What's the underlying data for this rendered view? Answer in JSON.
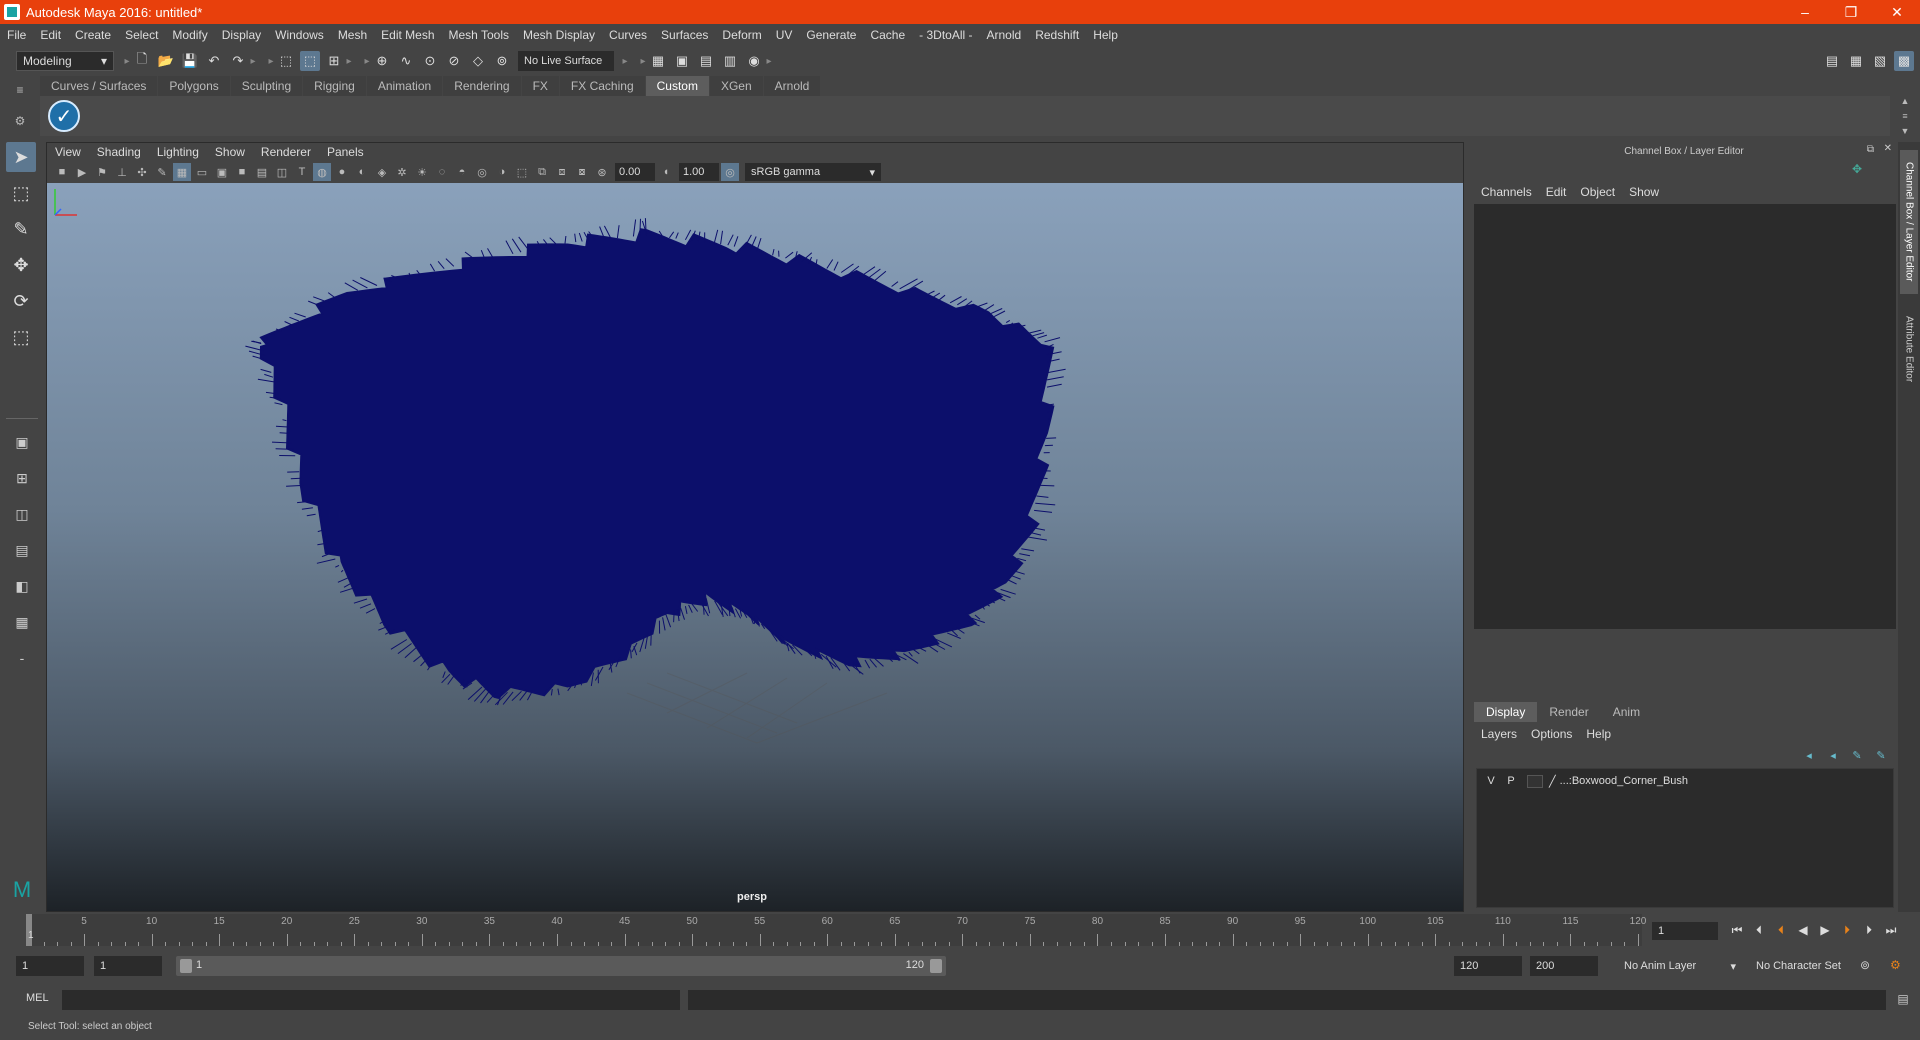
{
  "window": {
    "title": "Autodesk Maya 2016: untitled*",
    "controls": [
      "–",
      "❐",
      "✕"
    ]
  },
  "menubar": [
    "File",
    "Edit",
    "Create",
    "Select",
    "Modify",
    "Display",
    "Windows",
    "Mesh",
    "Edit Mesh",
    "Mesh Tools",
    "Mesh Display",
    "Curves",
    "Surfaces",
    "Deform",
    "UV",
    "Generate",
    "Cache",
    "- 3DtoAll -",
    "Arnold",
    "Redshift",
    "Help"
  ],
  "statusline": {
    "menuset": "Modeling",
    "live_surface": "No Live Surface"
  },
  "shelf": {
    "tabs": [
      "Curves / Surfaces",
      "Polygons",
      "Sculpting",
      "Rigging",
      "Animation",
      "Rendering",
      "FX",
      "FX Caching",
      "Custom",
      "XGen",
      "Arnold"
    ],
    "active_tab": "Custom"
  },
  "viewport": {
    "menus": [
      "View",
      "Shading",
      "Lighting",
      "Show",
      "Renderer",
      "Panels"
    ],
    "exposure": "0.00",
    "gamma": "1.00",
    "color_space": "sRGB gamma",
    "camera": "persp",
    "object_color": "#0c0f6b"
  },
  "channel_box": {
    "header": "Channel Box / Layer Editor",
    "menus": [
      "Channels",
      "Edit",
      "Object",
      "Show"
    ]
  },
  "layer_editor": {
    "tabs": [
      "Display",
      "Render",
      "Anim"
    ],
    "active_tab": "Display",
    "menus": [
      "Layers",
      "Options",
      "Help"
    ],
    "layers": [
      {
        "visible": "V",
        "playback": "P",
        "name": "...:Boxwood_Corner_Bush"
      }
    ]
  },
  "side_tabs": [
    "Channel Box / Layer Editor",
    "Attribute Editor"
  ],
  "timeslider": {
    "ticks": [
      "5",
      "10",
      "15",
      "20",
      "25",
      "30",
      "35",
      "40",
      "45",
      "50",
      "55",
      "60",
      "65",
      "70",
      "75",
      "80",
      "85",
      "90",
      "95",
      "100",
      "105",
      "110",
      "115",
      "120"
    ],
    "current_frame_label": "1",
    "current_frame": "1"
  },
  "range": {
    "start": "1",
    "playback_start": "1",
    "bar_start": "1",
    "bar_end": "120",
    "playback_end": "120",
    "end": "200",
    "anim_layer": "No Anim Layer",
    "character_set": "No Character Set"
  },
  "cmdline": {
    "label": "MEL"
  },
  "helpline": {
    "text": "Select Tool: select an object"
  }
}
